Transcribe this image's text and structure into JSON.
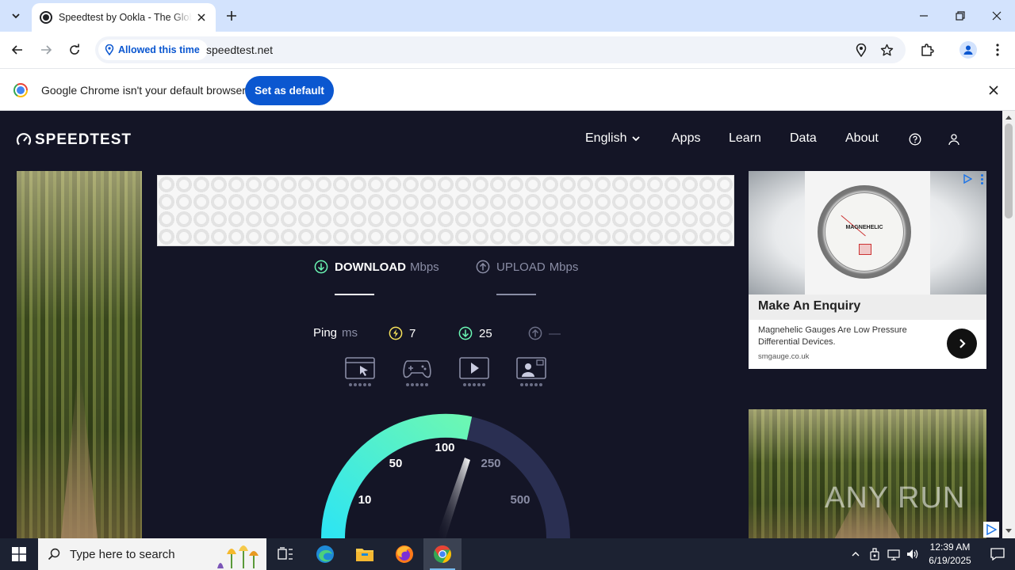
{
  "browser": {
    "tab": {
      "title": "Speedtest by Ookla - The Global Broadband Speed Test"
    },
    "permission_chip": "Allowed this time",
    "url": "speedtest.net",
    "infobar": {
      "message": "Google Chrome isn't your default browser",
      "button": "Set as default"
    }
  },
  "site": {
    "logo": "SPEEDTEST",
    "nav": {
      "language": "English",
      "apps": "Apps",
      "learn": "Learn",
      "data": "Data",
      "about": "About"
    },
    "tabs": {
      "download": {
        "label": "DOWNLOAD",
        "unit": "Mbps"
      },
      "upload": {
        "label": "UPLOAD",
        "unit": "Mbps"
      }
    },
    "ping": {
      "label": "Ping",
      "unit": "ms",
      "idle": "7",
      "download": "25",
      "upload": "—"
    },
    "gauge": {
      "labels": [
        "10",
        "50",
        "100",
        "250",
        "500"
      ],
      "accent_start": "#2ee5f2",
      "accent_end": "#6bf7b4"
    },
    "ad": {
      "dial_brand": "MAGNEHELIC",
      "headline": "Make An Enquiry",
      "body": "Magnehelic Gauges Are Low Pressure Differential Devices.",
      "domain": "smgauge.co.uk"
    },
    "watermark": "ANY RUN"
  },
  "taskbar": {
    "search_placeholder": "Type here to search",
    "time": "12:39 AM",
    "date": "6/19/2025"
  }
}
